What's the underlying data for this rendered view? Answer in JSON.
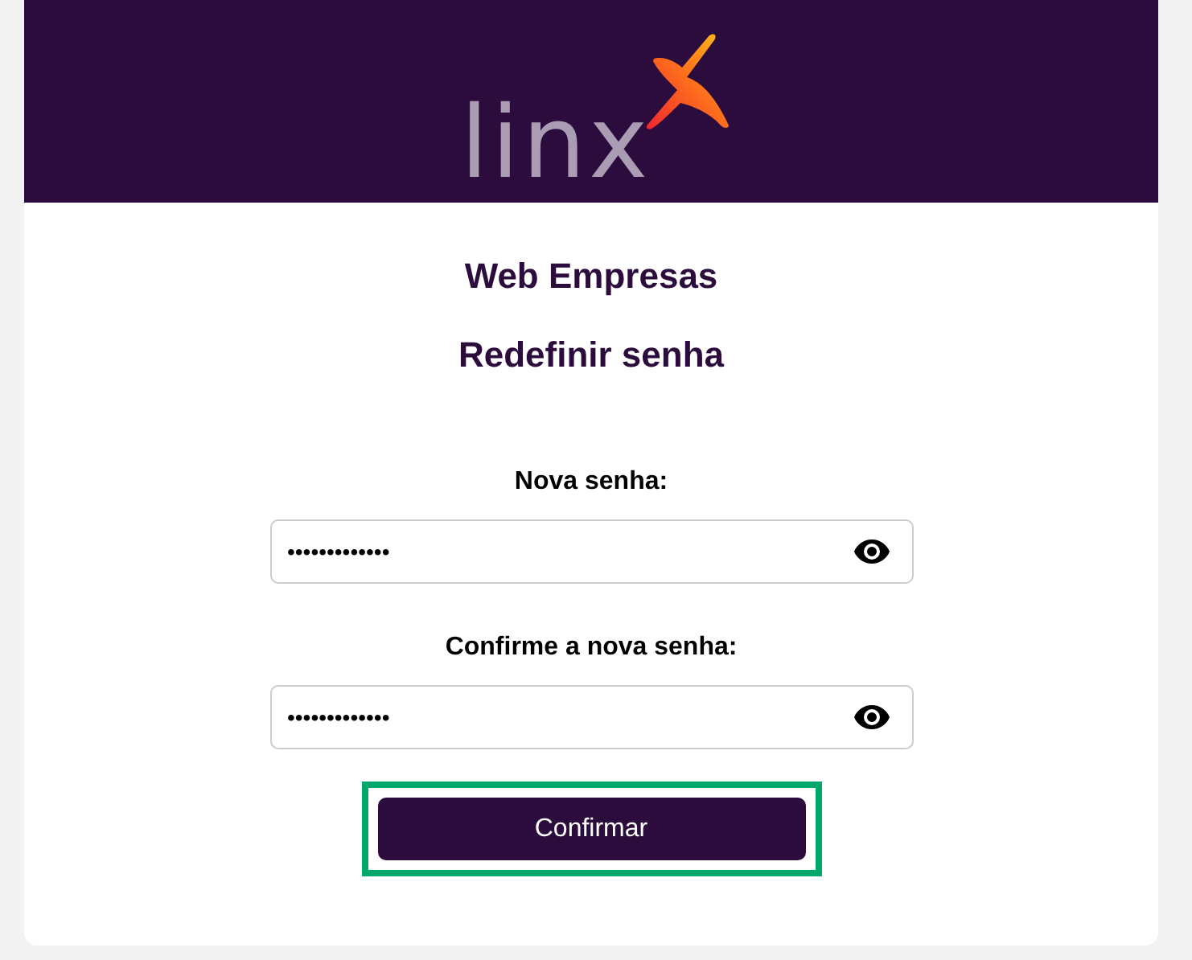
{
  "header": {
    "logo_text": "linx"
  },
  "app_title": "Web Empresas",
  "form_title": "Redefinir senha",
  "fields": [
    {
      "label": "Nova senha:",
      "value": "•••••••••••••",
      "revealed": false
    },
    {
      "label": "Confirme a nova senha:",
      "value": "•••••••••••••",
      "revealed": false
    }
  ],
  "submit": {
    "label": "Confirmar",
    "highlighted": true
  }
}
